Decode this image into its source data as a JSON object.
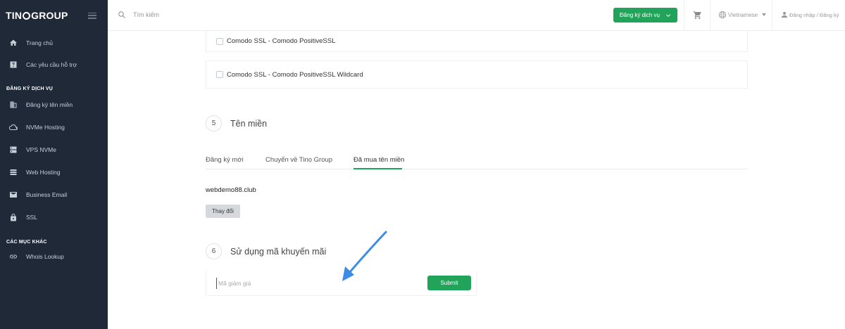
{
  "brand": {
    "part1": "TIN",
    "part2": "GROUP"
  },
  "sidebar": {
    "items_top": [
      {
        "label": "Trang chủ",
        "icon": "home-icon"
      },
      {
        "label": "Các yêu cầu hỗ trợ",
        "icon": "help-icon"
      }
    ],
    "section1": "ĐĂNG KÝ DỊCH VỤ",
    "items_services": [
      {
        "label": "Đăng ký tên miền",
        "icon": "domain-icon"
      },
      {
        "label": "NVMe Hosting",
        "icon": "cloud-icon"
      },
      {
        "label": "VPS NVMe",
        "icon": "server-icon"
      },
      {
        "label": "Web Hosting",
        "icon": "list-icon"
      },
      {
        "label": "Business Email",
        "icon": "mail-icon"
      },
      {
        "label": "SSL",
        "icon": "lock-icon"
      }
    ],
    "section2": "CÁC MỤC KHÁC",
    "items_other": [
      {
        "label": "Whois Lookup",
        "icon": "link-icon"
      }
    ]
  },
  "header": {
    "search_placeholder": "Tìm kiếm",
    "register_label": "Đăng ký dịch vụ",
    "language": "Vietnamese",
    "login_label": "Đăng nhập / Đăng ký"
  },
  "ssl_options": [
    "Comodo SSL - Comodo PositiveSSL",
    "Comodo SSL - Comodo PositiveSSL Wildcard"
  ],
  "step5": {
    "number": "5",
    "title": "Tên miền"
  },
  "domain_tabs": [
    {
      "label": "Đăng ký mới",
      "active": false
    },
    {
      "label": "Chuyển về Tino Group",
      "active": false
    },
    {
      "label": "Đã mua tên miền",
      "active": true
    }
  ],
  "domain_value": "webdemo88.club",
  "change_label": "Thay đổi",
  "step6": {
    "number": "6",
    "title": "Sử dụng mã khuyến mãi"
  },
  "promo": {
    "placeholder": "Mã giảm giá",
    "submit_label": "Submit"
  },
  "colors": {
    "sidebar_bg": "#1f2937",
    "accent_green": "#22a35a",
    "arrow_blue": "#3b8de8"
  }
}
